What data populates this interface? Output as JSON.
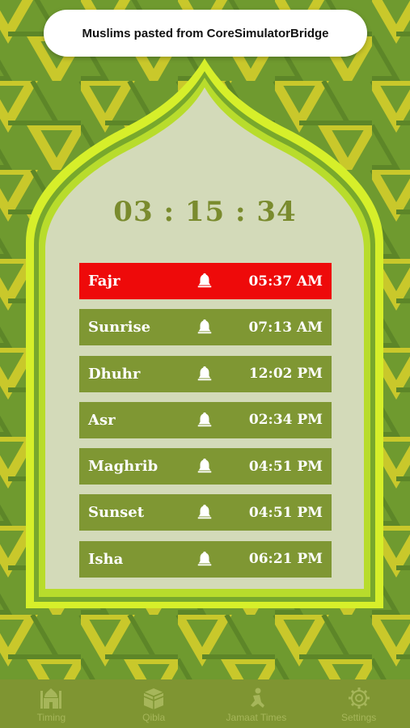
{
  "toast": {
    "message": "Muslims pasted from CoreSimulatorBridge"
  },
  "countdown": {
    "time": "03 : 15 : 34"
  },
  "prayers": [
    {
      "name": "Fajr",
      "time": "05:37 AM",
      "active": true,
      "icon": "bell-icon"
    },
    {
      "name": "Sunrise",
      "time": "07:13 AM",
      "active": false,
      "icon": "bell-icon"
    },
    {
      "name": "Dhuhr",
      "time": "12:02 PM",
      "active": false,
      "icon": "bell-icon"
    },
    {
      "name": "Asr",
      "time": "02:34 PM",
      "active": false,
      "icon": "bell-icon"
    },
    {
      "name": "Maghrib",
      "time": "04:51 PM",
      "active": false,
      "icon": "bell-icon"
    },
    {
      "name": "Sunset",
      "time": "04:51 PM",
      "active": false,
      "icon": "bell-icon"
    },
    {
      "name": "Isha",
      "time": "06:21 PM",
      "active": false,
      "icon": "bell-icon"
    }
  ],
  "tabs": [
    {
      "label": "Timing",
      "icon": "mosque-icon"
    },
    {
      "label": "Qibla",
      "icon": "kaaba-icon"
    },
    {
      "label": "Jamaat Times",
      "icon": "praying-person-icon"
    },
    {
      "label": "Settings",
      "icon": "gear-icon"
    }
  ],
  "colors": {
    "background_green": "#6f9a2f",
    "pattern_yellow": "#c9c82b",
    "arch_lime": "#d6ef2a",
    "panel": "#d3dab9",
    "row_green": "#7f9733",
    "row_active": "#ee0a0a",
    "countdown_text": "#7a8b2e",
    "tabbar": "#7f9532",
    "tab_icon": "#a6b65a"
  }
}
